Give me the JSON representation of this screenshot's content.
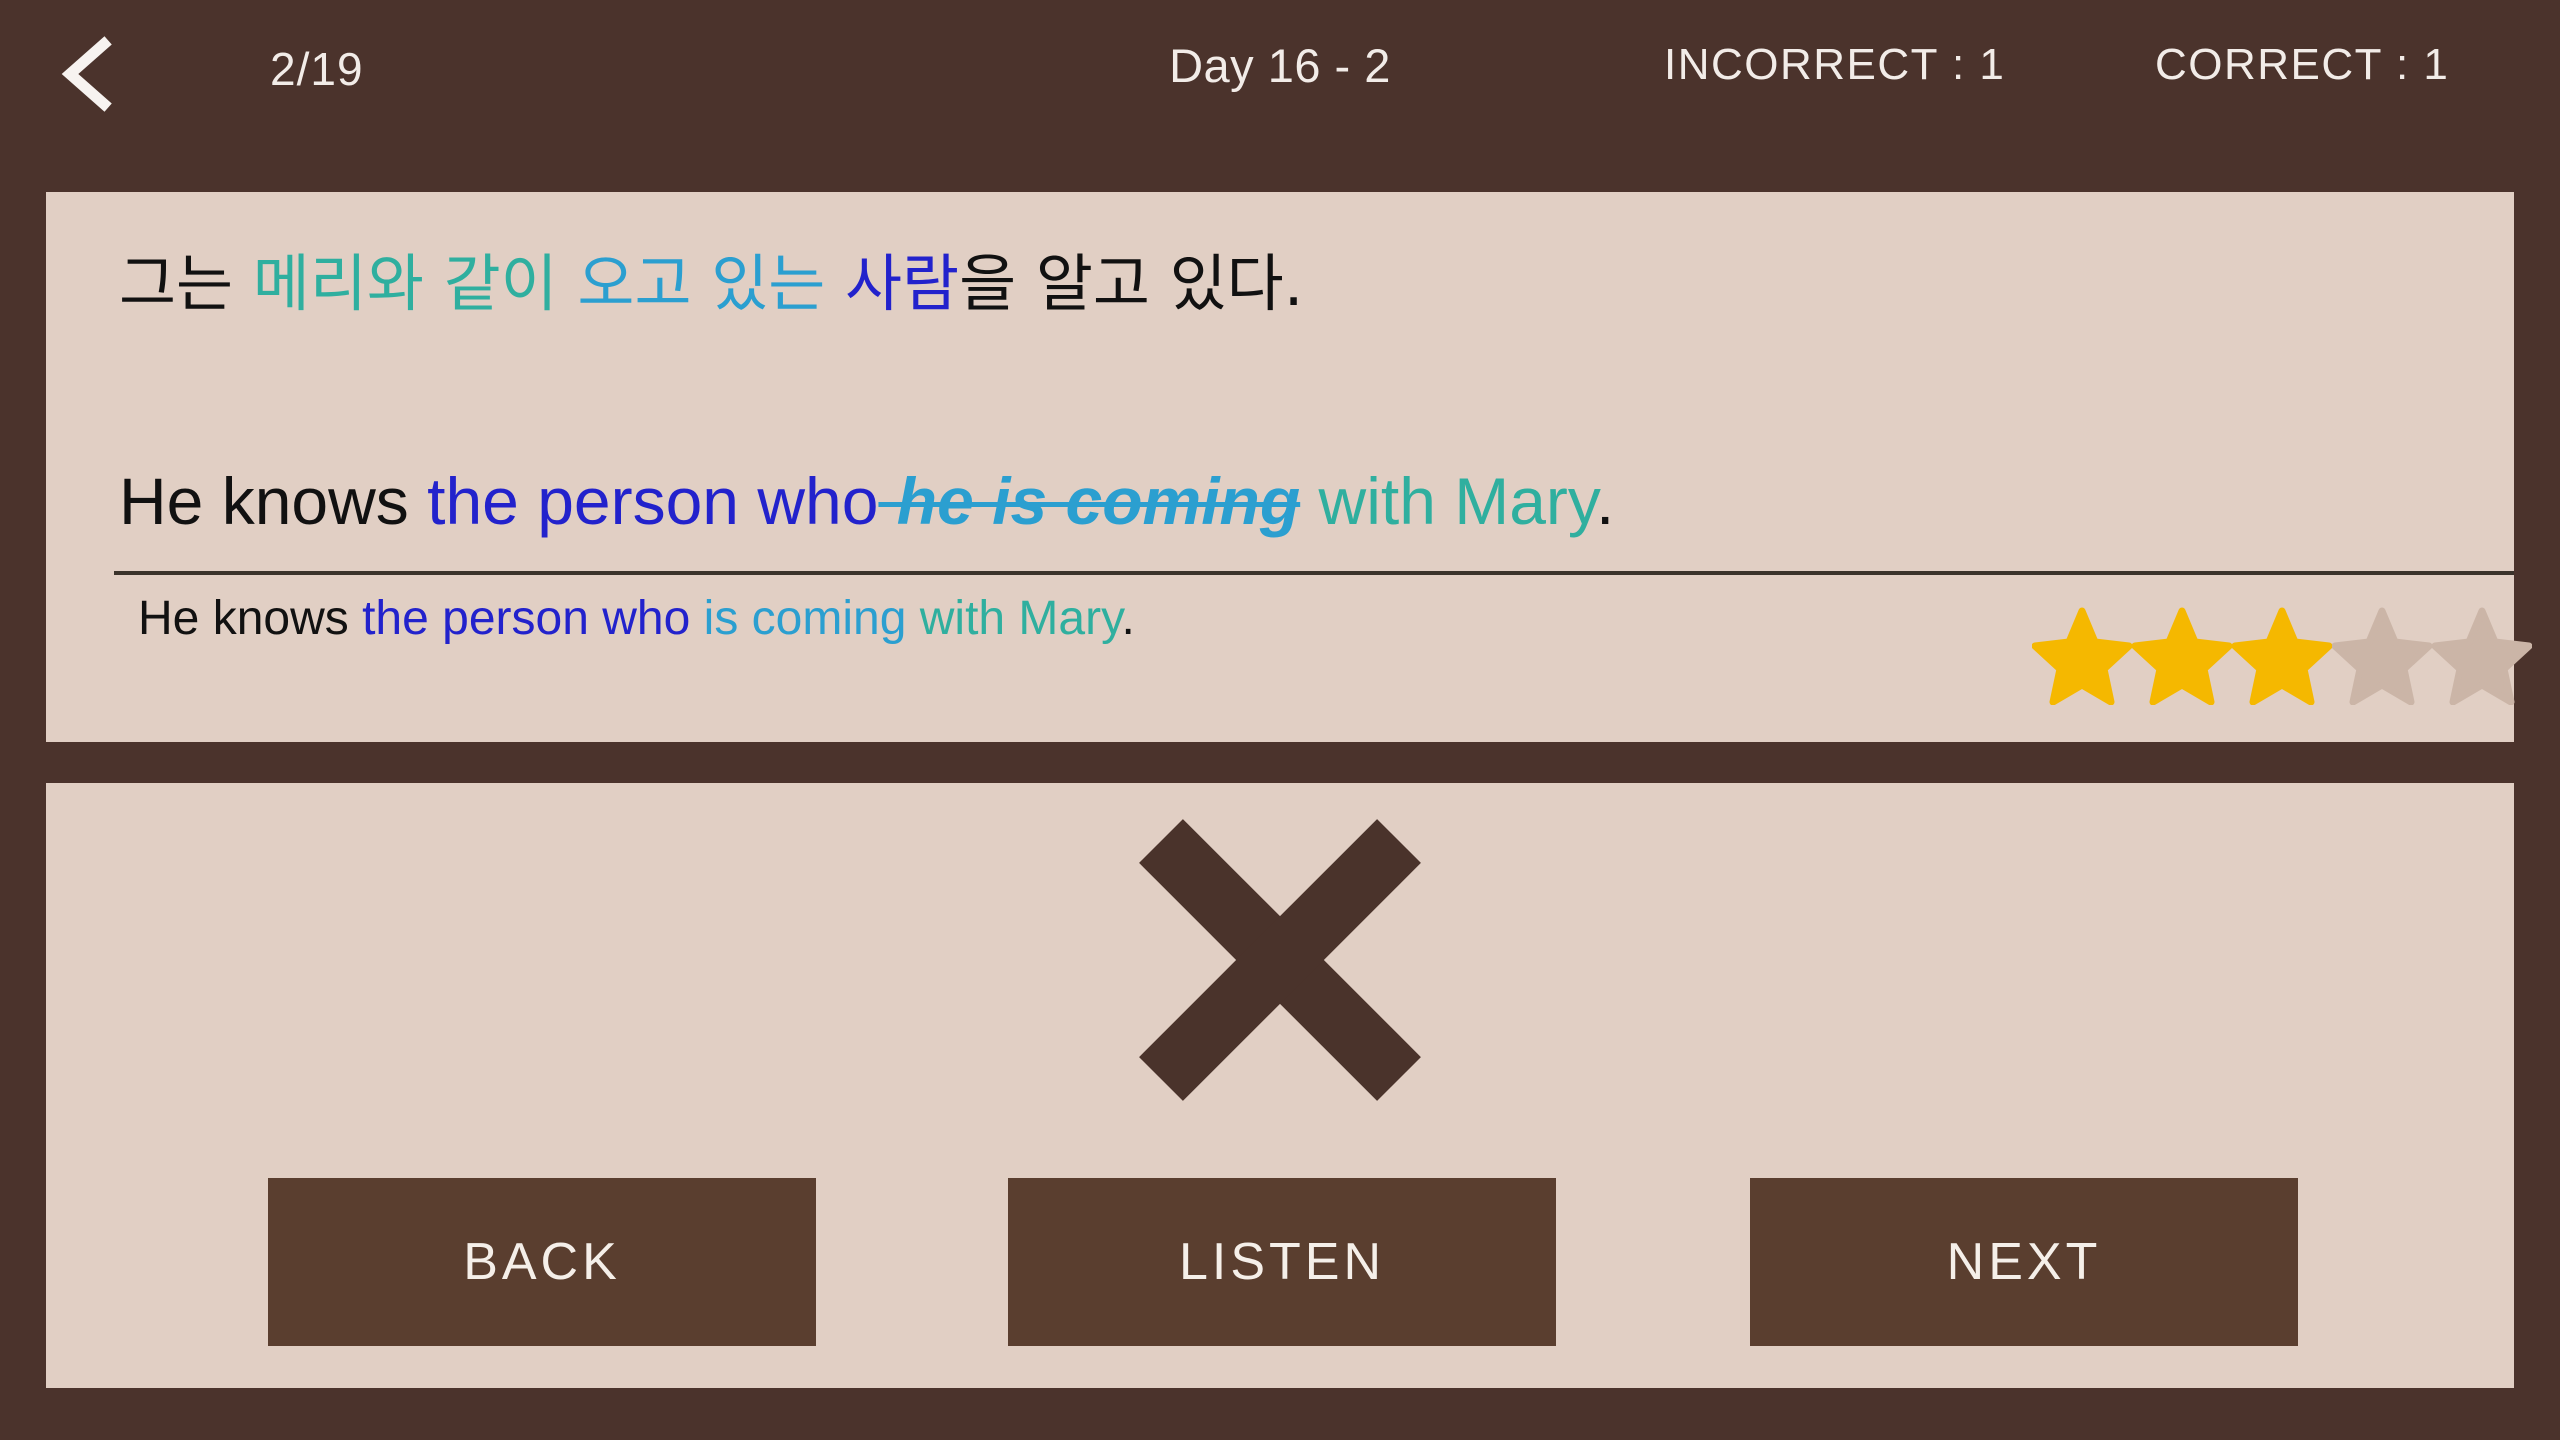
{
  "header": {
    "back_icon": "chevron-left-icon",
    "progress": "2/19",
    "lesson_title": "Day 16 - 2",
    "incorrect_stat": "INCORRECT : 1",
    "correct_stat": "CORRECT : 1"
  },
  "question": {
    "korean": {
      "segments": [
        {
          "text": "그는 ",
          "color": "#111111"
        },
        {
          "text": "메리와 같이 ",
          "color": "#2faf9f"
        },
        {
          "text": "오고 있는 ",
          "color": "#2b9fd0"
        },
        {
          "text": "사람",
          "color": "#2222cc"
        },
        {
          "text": "을 알고 있다.",
          "color": "#111111"
        }
      ],
      "full_text": "그는 메리와 같이 오고 있는 사람을 알고 있다."
    },
    "user_answer": {
      "segments": [
        {
          "text": "He knows ",
          "color": "#111111",
          "strike": false
        },
        {
          "text": "the person who",
          "color": "#2222cc",
          "strike": false
        },
        {
          "text": " he is coming",
          "color": "#2b9fd0",
          "strike": true
        },
        {
          "text": " with Mary",
          "color": "#2faf9f",
          "strike": false
        },
        {
          "text": ".",
          "color": "#111111",
          "strike": false
        }
      ],
      "full_text": "He knows the person who he is coming with Mary."
    },
    "correct_answer": {
      "segments": [
        {
          "text": "He knows ",
          "color": "#111111"
        },
        {
          "text": "the person who ",
          "color": "#2222cc"
        },
        {
          "text": "is coming ",
          "color": "#2b9fd0"
        },
        {
          "text": "with Mary",
          "color": "#2faf9f"
        },
        {
          "text": ".",
          "color": "#111111"
        }
      ],
      "full_text": "He knows the person who is coming with Mary."
    },
    "rating": {
      "filled": 3,
      "total": 5,
      "filled_color": "#f5b800",
      "empty_color": "#cbb5a7"
    }
  },
  "result": {
    "mark": "cross-icon",
    "mark_meaning": "incorrect",
    "mark_color": "#4a332b"
  },
  "buttons": {
    "back_label": "BACK",
    "listen_label": "LISTEN",
    "next_label": "NEXT"
  },
  "colors": {
    "background": "#4b332c",
    "panel": "#e1cfc4",
    "button": "#5a3e2f",
    "text_light": "#f2ece8",
    "black": "#111111",
    "blue": "#2222cc",
    "light_blue": "#2b9fd0",
    "teal": "#2faf9f",
    "divider": "#3b332b"
  }
}
